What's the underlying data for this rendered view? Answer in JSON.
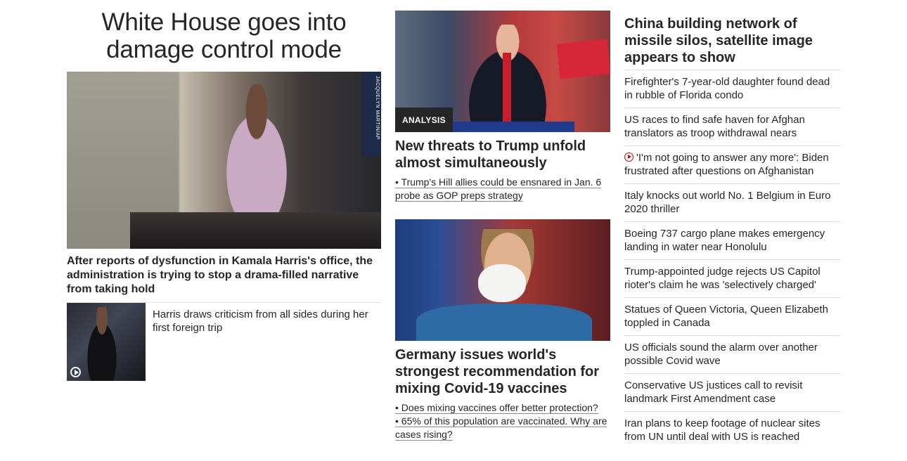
{
  "col1": {
    "title": "White House goes into damage control mode",
    "hero_image_credit": "JACQUELYN MARTIN/AP",
    "hero_caption": "After reports of dysfunction in Kamala Harris's office, the administration is trying to stop a drama-filled narrative from taking hold",
    "related_text": "Harris draws criticism from all sides during her first foreign trip"
  },
  "col2": {
    "story1": {
      "badge": "ANALYSIS",
      "headline": "New threats to Trump unfold almost simultaneously",
      "bullets": [
        "• Trump's Hill allies could be ensnared in Jan. 6 probe as GOP preps strategy"
      ]
    },
    "story2": {
      "headline": "Germany issues world's strongest recommendation for mixing Covid-19 vaccines",
      "bullets": [
        "• Does mixing vaccines offer better protection?",
        "• 65% of this population are vaccinated. Why are cases rising?"
      ]
    }
  },
  "col3": {
    "title": "China building network of missile silos, satellite image appears to show",
    "items": [
      "Firefighter's 7-year-old daughter found dead in rubble of Florida condo",
      "US races to find safe haven for Afghan translators as troop withdrawal nears",
      "'I'm not going to answer any more': Biden frustrated after questions on Afghanistan",
      "Italy knocks out world No. 1 Belgium in Euro 2020 thriller",
      "Boeing 737 cargo plane makes emergency landing in water near Honolulu",
      "Trump-appointed judge rejects US Capitol rioter's claim he was 'selectively charged'",
      "Statues of Queen Victoria, Queen Elizabeth toppled in Canada",
      "US officials sound the alarm over another possible Covid wave",
      "Conservative US justices call to revisit landmark First Amendment case",
      "Iran plans to keep footage of nuclear sites from UN until deal with US is reached"
    ]
  }
}
